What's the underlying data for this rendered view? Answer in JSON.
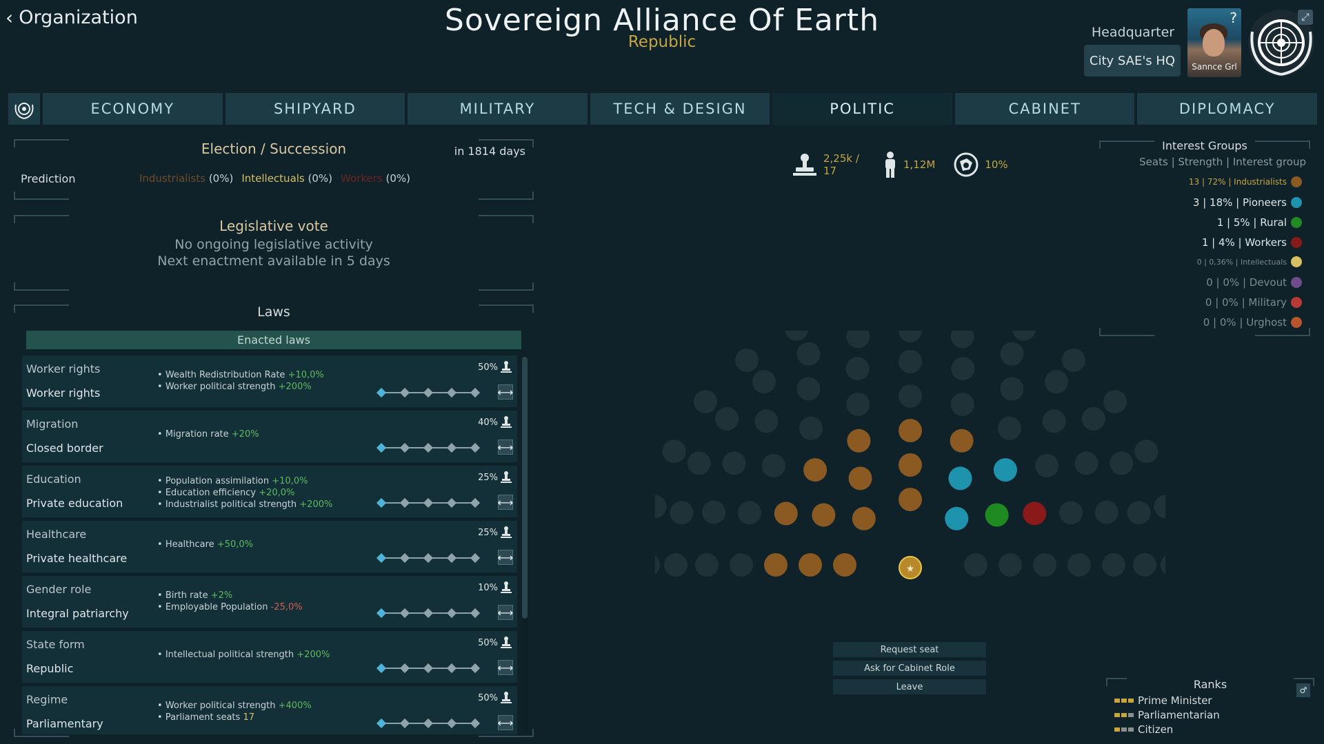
{
  "header": {
    "back_label": "Organization",
    "title": "Sovereign Alliance Of Earth",
    "subtitle": "Republic",
    "hq_label": "Headquarter",
    "hq_button": "City SAE's HQ",
    "portrait_name": "Sannce Grl",
    "portrait_help": "?"
  },
  "tabs": [
    {
      "label": "ECONOMY"
    },
    {
      "label": "SHIPYARD"
    },
    {
      "label": "MILITARY"
    },
    {
      "label": "TECH & DESIGN"
    },
    {
      "label": "POLITIC"
    },
    {
      "label": "CABINET"
    },
    {
      "label": "DIPLOMACY"
    }
  ],
  "active_tab": "POLITIC",
  "election": {
    "title": "Election / Succession",
    "days": "in 1814 days",
    "prediction_label": "Prediction",
    "prediction": [
      {
        "name": "Industrialists",
        "pct": "(0%)"
      },
      {
        "name": "Intellectuals",
        "pct": "(0%)"
      },
      {
        "name": "Workers",
        "pct": "(0%)"
      }
    ]
  },
  "legislative": {
    "title": "Legislative vote",
    "line1": "No ongoing legislative activity",
    "line2": "Next enactment available in 5 days"
  },
  "laws": {
    "title": "Laws",
    "enacted_label": "Enacted laws",
    "items": [
      {
        "category": "Worker rights",
        "value": "Worker rights",
        "pct": "50%",
        "effects": [
          [
            "Wealth Redistribution Rate ",
            "+10,0%",
            "pos"
          ],
          [
            "Worker political strength ",
            "+200%",
            "pos"
          ]
        ],
        "slider": 0
      },
      {
        "category": "Migration",
        "value": "Closed border",
        "pct": "40%",
        "effects": [
          [
            "Migration rate ",
            "+20%",
            "pos"
          ]
        ],
        "slider": 0
      },
      {
        "category": "Education",
        "value": "Private education",
        "pct": "25%",
        "effects": [
          [
            "Population assimilation ",
            "+10,0%",
            "pos"
          ],
          [
            "Education efficiency ",
            "+20,0%",
            "pos"
          ],
          [
            "Industrialist political strength ",
            "+200%",
            "pos"
          ]
        ],
        "slider": 0
      },
      {
        "category": "Healthcare",
        "value": "Private healthcare",
        "pct": "25%",
        "effects": [
          [
            "Healthcare ",
            "+50,0%",
            "pos"
          ]
        ],
        "slider": 0
      },
      {
        "category": "Gender role",
        "value": "Integral patriarchy",
        "pct": "10%",
        "effects": [
          [
            "Birth rate ",
            "+2%",
            "pos"
          ],
          [
            "Employable Population ",
            "-25,0%",
            "neg"
          ]
        ],
        "slider": 0
      },
      {
        "category": "State form",
        "value": "Republic",
        "pct": "50%",
        "effects": [
          [
            "Intellectual political strength ",
            "+200%",
            "pos"
          ]
        ],
        "slider": 0
      },
      {
        "category": "Regime",
        "value": "Parliamentary",
        "pct": "50%",
        "effects": [
          [
            "Worker political strength ",
            "+400%",
            "pos"
          ],
          [
            "Parliament seats ",
            "17",
            "gold"
          ]
        ],
        "slider": 0
      }
    ]
  },
  "stats": {
    "members": "2,25k / 17",
    "population": "1,12M",
    "support": "10%"
  },
  "parliament": {
    "seats": [
      {
        "group": "Industrialists",
        "count": 13,
        "color": "#8a5a22"
      },
      {
        "group": "Pioneers",
        "count": 3,
        "color": "#1e93ad"
      },
      {
        "group": "Rural",
        "count": 1,
        "color": "#1f8a22"
      },
      {
        "group": "Workers",
        "count": 1,
        "color": "#8a1a1a"
      }
    ],
    "empty_color": "#1f3238",
    "player_seat_color": "#b8892a"
  },
  "actions": {
    "request_seat": "Request seat",
    "ask_cabinet": "Ask for Cabinet Role",
    "leave": "Leave"
  },
  "interest_groups": {
    "title": "Interest Groups",
    "subtitle": "Seats | Strength | Interest group",
    "items": [
      {
        "label": "13 | 72% | Industrialists",
        "color": "#8a5a22",
        "text_color": "#c6a640",
        "size": 12
      },
      {
        "label": "3 | 18% | Pioneers",
        "color": "#1e93ad",
        "text_color": "#dfe6e8",
        "size": 15
      },
      {
        "label": "1 | 5% | Rural",
        "color": "#1f8a22",
        "text_color": "#dfe6e8",
        "size": 15
      },
      {
        "label": "1 | 4% | Workers",
        "color": "#8a1a1a",
        "text_color": "#dfe6e8",
        "size": 15
      },
      {
        "label": "0 | 0,36% | Intellectuals",
        "color": "#d6c062",
        "text_color": "#7c8a8e",
        "size": 11
      },
      {
        "label": "0 | 0% | Devout",
        "color": "#6d4d8a",
        "text_color": "#7c8a8e",
        "size": 15
      },
      {
        "label": "0 | 0% | Military",
        "color": "#b83a32",
        "text_color": "#7c8a8e",
        "size": 15
      },
      {
        "label": "0 | 0% | Urghost",
        "color": "#b8552a",
        "text_color": "#7c8a8e",
        "size": 15
      }
    ]
  },
  "ranks": {
    "title": "Ranks",
    "items": [
      {
        "label": "Prime Minister",
        "pips": 3
      },
      {
        "label": "Parliamentarian",
        "pips": 2
      },
      {
        "label": "Citizen",
        "pips": 1
      }
    ]
  }
}
